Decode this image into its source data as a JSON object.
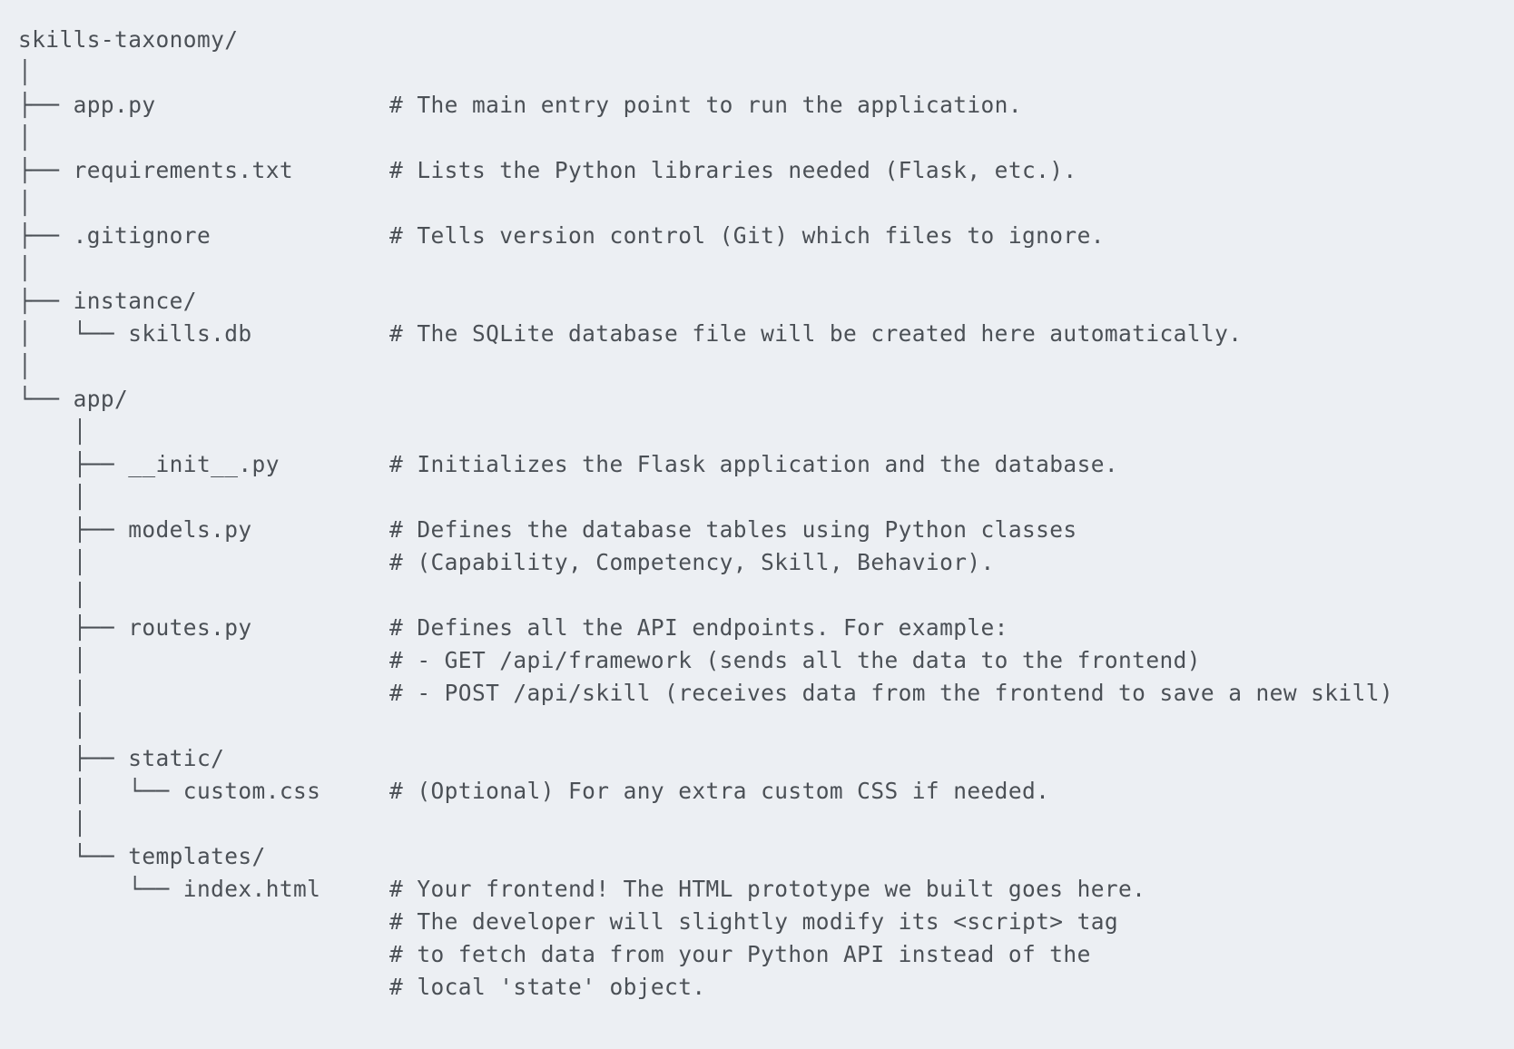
{
  "document": {
    "lines": [
      "skills-taxonomy/",
      "│",
      "├── app.py                 # The main entry point to run the application.",
      "│",
      "├── requirements.txt       # Lists the Python libraries needed (Flask, etc.).",
      "│",
      "├── .gitignore             # Tells version control (Git) which files to ignore.",
      "│",
      "├── instance/",
      "│   └── skills.db          # The SQLite database file will be created here automatically.",
      "│",
      "└── app/",
      "    │",
      "    ├── __init__.py        # Initializes the Flask application and the database.",
      "    │",
      "    ├── models.py          # Defines the database tables using Python classes",
      "    │                      # (Capability, Competency, Skill, Behavior).",
      "    │",
      "    ├── routes.py          # Defines all the API endpoints. For example:",
      "    │                      # - GET /api/framework (sends all the data to the frontend)",
      "    │                      # - POST /api/skill (receives data from the frontend to save a new skill)",
      "    │",
      "    ├── static/",
      "    │   └── custom.css     # (Optional) For any extra custom CSS if needed.",
      "    │",
      "    └── templates/",
      "        └── index.html     # Your frontend! The HTML prototype we built goes here.",
      "                           # The developer will slightly modify its <script> tag",
      "                           # to fetch data from your Python API instead of the",
      "                           # local 'state' object."
    ]
  }
}
